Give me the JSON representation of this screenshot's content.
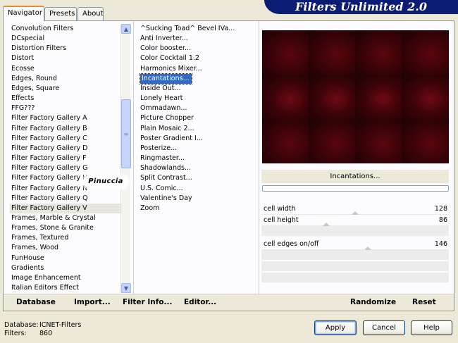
{
  "tabs": [
    "Navigator",
    "Presets",
    "About"
  ],
  "banner": {
    "title": "Filters Unlimited 2.0"
  },
  "categories": [
    "Convolution Filters",
    "DCspecial",
    "Distortion Filters",
    "Distort",
    "Ecosse",
    "Edges, Round",
    "Edges, Square",
    "Effects",
    "FFG???",
    "Filter Factory Gallery A",
    "Filter Factory Gallery B",
    "Filter Factory Gallery C",
    "Filter Factory Gallery D",
    "Filter Factory Gallery F",
    "Filter Factory Gallery G",
    "Filter Factory Gallery H",
    "Filter Factory Gallery N",
    "Filter Factory Gallery Q",
    "Filter Factory Gallery V",
    "Frames, Marble & Crystal",
    "Frames, Stone & Granite",
    "Frames, Textured",
    "Frames, Wood",
    "FunHouse",
    "Gradients",
    "Image Enhancement",
    "Italian Editors Effect"
  ],
  "selected_category": "Filter Factory Gallery V",
  "filters": [
    "^Sucking Toad^  Bevel IVa...",
    "Anti Inverter...",
    "Color booster...",
    "Color Cocktail 1.2",
    "Harmonics Mixer...",
    "Incantations...",
    "Inside Out...",
    "Lonely Heart",
    "Ommadawn...",
    "Picture Chopper",
    "Plain Mosaic 2...",
    "Poster Gradient I...",
    "Posterize...",
    "Ringmaster...",
    "Shadowlands...",
    "Split Contrast...",
    "U.S. Comic...",
    "Valentine's Day",
    "Zoom"
  ],
  "selected_filter": "Incantations...",
  "watermark": "Pinuccia",
  "preview": {
    "colors": [
      "#1b0204",
      "#3c0308",
      "#5a0610",
      "#6e0a14"
    ]
  },
  "filter_name": "Incantations...",
  "params": [
    {
      "label": "cell width",
      "value": "128",
      "level": 0.5
    },
    {
      "label": "cell height",
      "value": "86",
      "level": 0.34
    },
    {
      "label": "cell edges on/off",
      "value": "146",
      "level": 0.57
    }
  ],
  "bar": {
    "database": "Database",
    "import": "Import...",
    "filter_info": "Filter Info...",
    "editor": "Editor...",
    "randomize": "Randomize",
    "reset": "Reset"
  },
  "status": {
    "database_label": "Database:",
    "database_value": "ICNET-Filters",
    "filters_label": "Filters:",
    "filters_value": "860"
  },
  "buttons": {
    "apply": "Apply",
    "cancel": "Cancel",
    "help": "Help"
  }
}
